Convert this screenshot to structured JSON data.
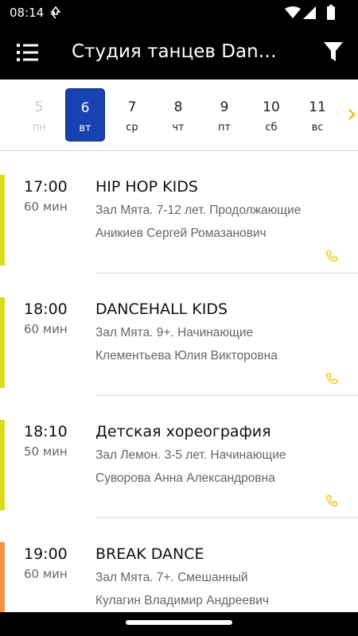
{
  "status_bar": {
    "time": "08:14"
  },
  "app_bar": {
    "title": "Студия танцев Dance Life",
    "menu_icon": "menu-icon",
    "filter_icon": "filter-icon"
  },
  "dates": [
    {
      "num": "5",
      "dow": "пн",
      "state": "past"
    },
    {
      "num": "6",
      "dow": "вт",
      "state": "selected"
    },
    {
      "num": "7",
      "dow": "ср",
      "state": "normal"
    },
    {
      "num": "8",
      "dow": "чт",
      "state": "normal"
    },
    {
      "num": "9",
      "dow": "пт",
      "state": "normal"
    },
    {
      "num": "10",
      "dow": "сб",
      "state": "normal"
    },
    {
      "num": "11",
      "dow": "вс",
      "state": "normal"
    }
  ],
  "classes": [
    {
      "time": "17:00",
      "duration": "60 мин",
      "title": "HIP HOP KIDS",
      "details": "Зал Мята. 7-12 лет. Продолжающие",
      "teacher": "Аникиев Сергей Ромазанович",
      "color": "#d8dc1f"
    },
    {
      "time": "18:00",
      "duration": "60 мин",
      "title": "DANCEHALL KIDS",
      "details": "Зал Мята. 9+. Начинающие",
      "teacher": "Клементьева Юлия Викторовна",
      "color": "#d8dc1f"
    },
    {
      "time": "18:10",
      "duration": "50 мин",
      "title": "Детская хореография",
      "details": "Зал Лемон. 3-5 лет. Начинающие",
      "teacher": "Суворова Анна Александровна",
      "color": "#d8dc1f"
    },
    {
      "time": "19:00",
      "duration": "60 мин",
      "title": "BREAK DANCE",
      "details": "Зал Мята. 7+. Смешанный",
      "teacher": "Кулагин Владимир Андреевич",
      "color": "#f0934a"
    }
  ],
  "colors": {
    "accent": "#1742b0",
    "phone": "#f2c200",
    "chevron": "#f2c200"
  }
}
